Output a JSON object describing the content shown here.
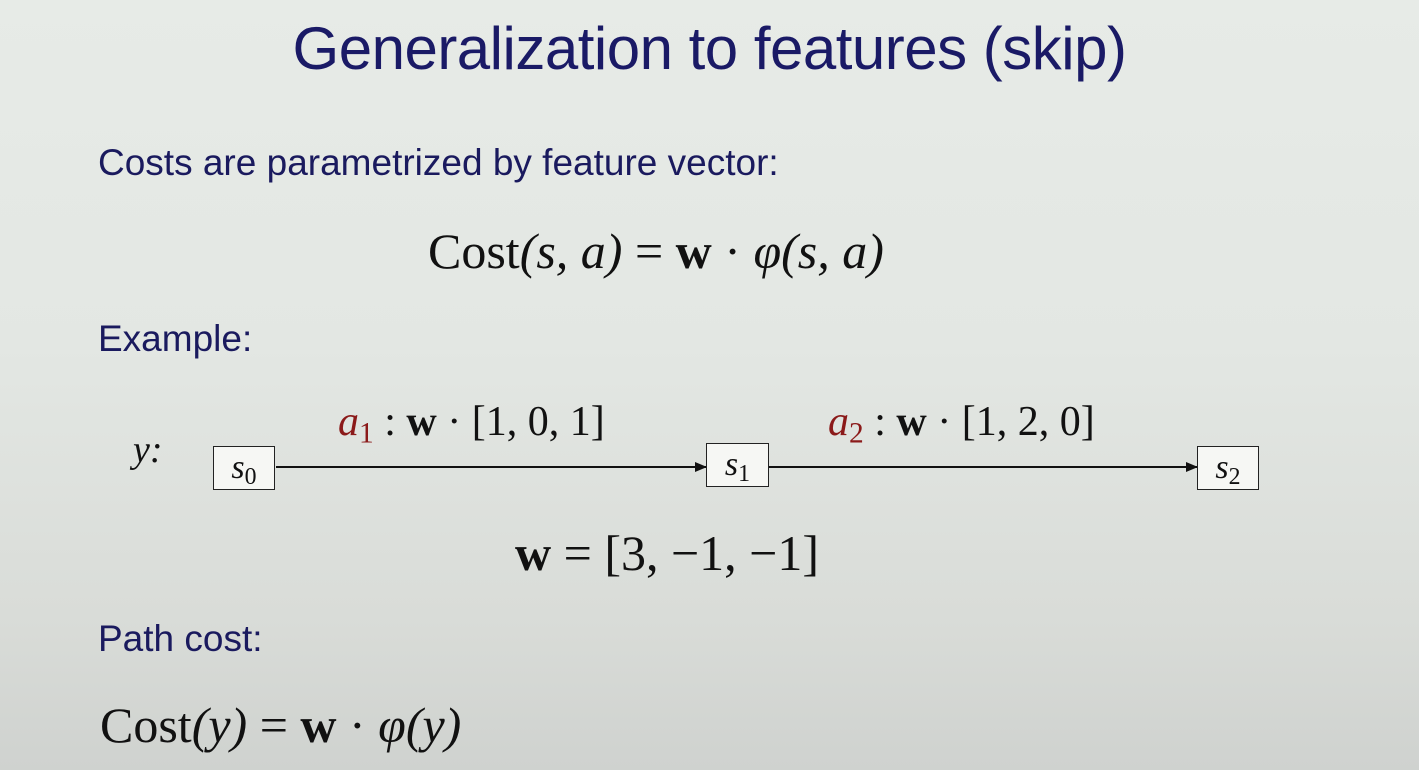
{
  "slide": {
    "title": "Generalization to features (skip)",
    "intro": "Costs are parametrized by feature vector:",
    "formula": {
      "name": "Cost",
      "args": "(s, a)",
      "equals": "=",
      "weight": "w",
      "dot": "·",
      "phi": "φ",
      "phi_args": "(s, a)"
    },
    "example_label": "Example:",
    "path_label": "y:",
    "states": [
      {
        "base": "s",
        "sub": "0"
      },
      {
        "base": "s",
        "sub": "1"
      },
      {
        "base": "s",
        "sub": "2"
      }
    ],
    "actions": [
      {
        "base": "a",
        "sub": "1",
        "colon": ":",
        "weight": "w",
        "dot": "·",
        "vector": "[1, 0, 1]"
      },
      {
        "base": "a",
        "sub": "2",
        "colon": ":",
        "weight": "w",
        "dot": "·",
        "vector": "[1, 2, 0]"
      }
    ],
    "weights": {
      "weight": "w",
      "equals": "=",
      "vector": "[3, −1, −1]"
    },
    "path_cost_label": "Path cost:",
    "path_formula": {
      "name": "Cost",
      "args": "(y)",
      "equals": "=",
      "weight": "w",
      "dot": "·",
      "phi": "φ",
      "phi_args": "(y)"
    }
  },
  "colors": {
    "title": "#1a1a66",
    "text": "#1a1a5e",
    "action_label": "#8b1a1a"
  }
}
